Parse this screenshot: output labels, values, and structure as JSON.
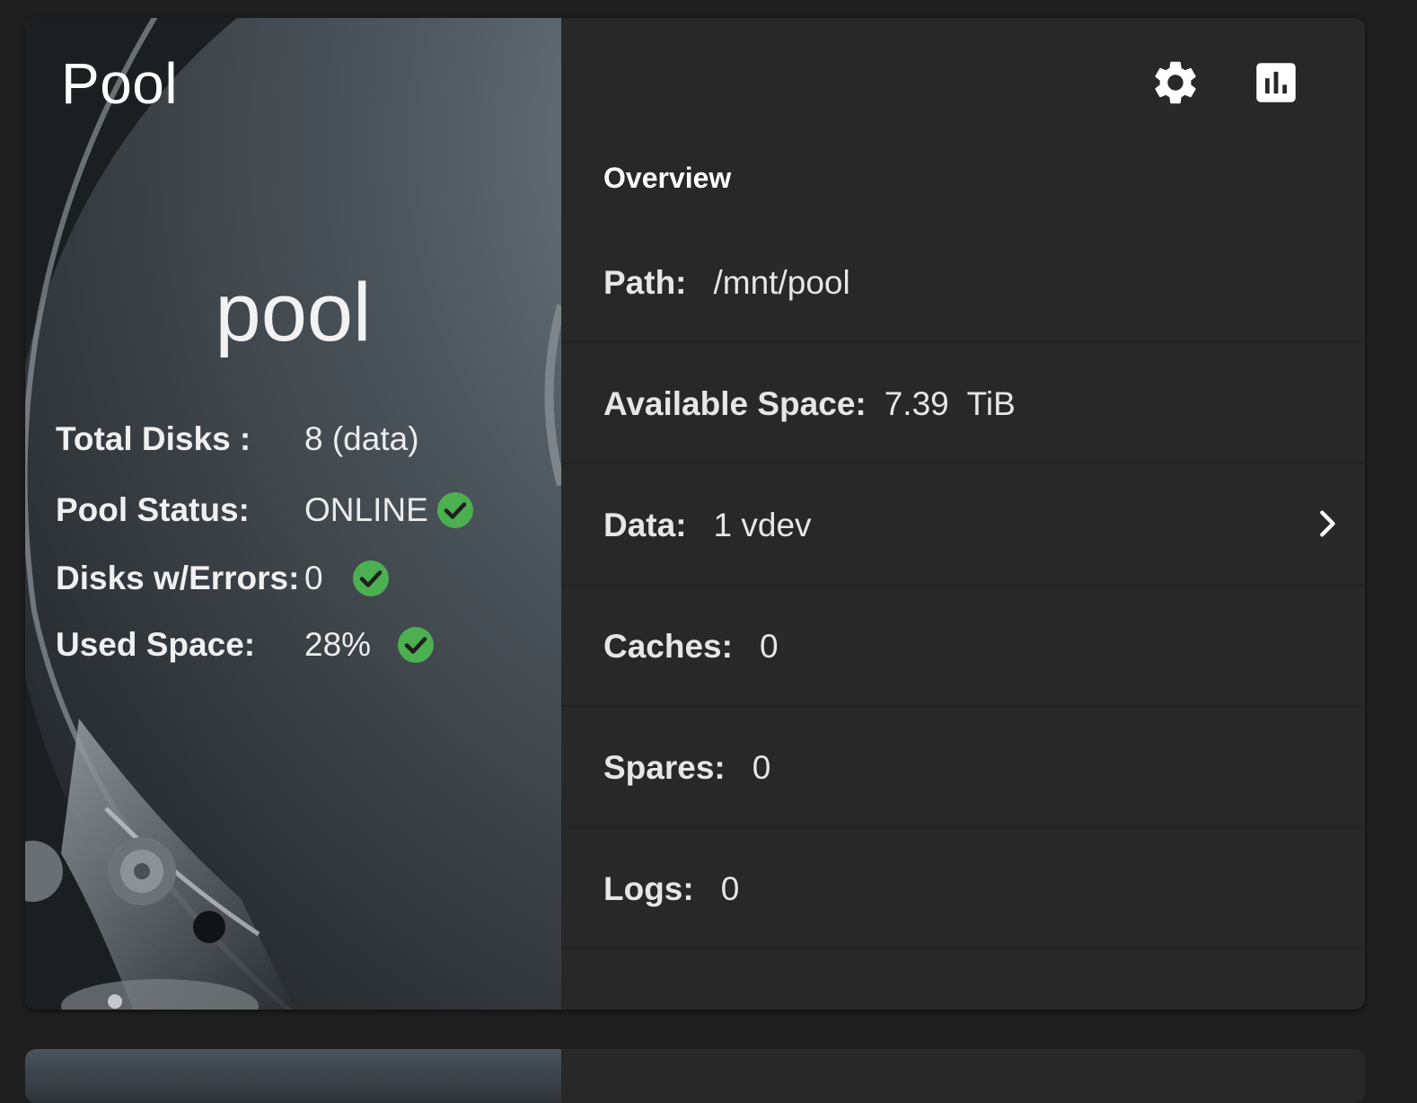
{
  "card": {
    "title": "Pool",
    "pool_name": "pool"
  },
  "stats": [
    {
      "label": "Total Disks :",
      "value": "8 (data)",
      "ok": false
    },
    {
      "label": "Pool Status:",
      "value": "ONLINE",
      "ok": true
    },
    {
      "label": "Disks w/Errors:",
      "value": "0",
      "ok": true
    },
    {
      "label": "Used Space:",
      "value": "28%",
      "ok": true
    }
  ],
  "toolbar": {
    "settings_icon": "gear-icon",
    "reports_icon": "bar-chart-icon"
  },
  "overview": {
    "title": "Overview",
    "rows": [
      {
        "label": "Path:",
        "value": "/mnt/pool"
      },
      {
        "label": "Available Space:",
        "value": "7.39  TiB"
      },
      {
        "label": "Data:",
        "value": "1 vdev",
        "expandable": true
      },
      {
        "label": "Caches:",
        "value": "0"
      },
      {
        "label": "Spares:",
        "value": "0"
      },
      {
        "label": "Logs:",
        "value": "0"
      }
    ]
  },
  "colors": {
    "background": "#1e1e1e",
    "card": "#282828",
    "ok_green": "#4caf50",
    "text": "#ffffff"
  }
}
